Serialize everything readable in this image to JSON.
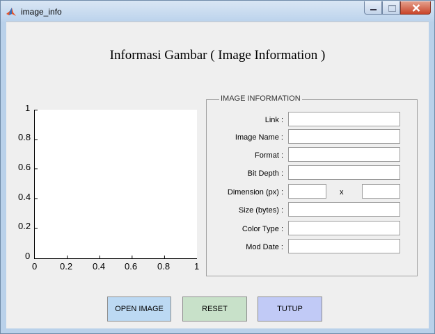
{
  "window": {
    "title": "image_info"
  },
  "heading": "Informasi Gambar ( Image Information )",
  "axes": {
    "y_ticks": [
      "1",
      "0.8",
      "0.6",
      "0.4",
      "0.2",
      "0"
    ],
    "x_ticks": [
      "0",
      "0.2",
      "0.4",
      "0.6",
      "0.8",
      "1"
    ]
  },
  "panel": {
    "title": "IMAGE INFORMATION",
    "link_label": "Link :",
    "image_name_label": "Image Name :",
    "format_label": "Format  :",
    "bit_depth_label": "Bit Depth  :",
    "dimension_label": "Dimension (px)  :",
    "dimension_separator": "x",
    "size_label": "Size (bytes)  :",
    "color_type_label": "Color Type  :",
    "mod_date_label": "Mod Date  :",
    "link_value": "",
    "image_name_value": "",
    "format_value": "",
    "bit_depth_value": "",
    "dimension_width_value": "",
    "dimension_height_value": "",
    "size_value": "",
    "color_type_value": "",
    "mod_date_value": ""
  },
  "buttons": {
    "open": "OPEN IMAGE",
    "reset": "RESET",
    "close": "TUTUP"
  },
  "colors": {
    "open_button": "#bcd9f3",
    "reset_button": "#c8e1c9",
    "close_button": "#c1caf6",
    "window_frame": "#b9d1ea",
    "client_background": "#efefef"
  },
  "icons": {
    "app": "matlab-icon",
    "minimize": "minimize-icon",
    "maximize": "maximize-icon",
    "close": "close-icon"
  }
}
